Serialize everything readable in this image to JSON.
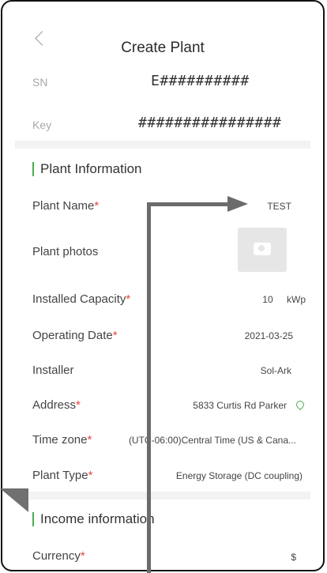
{
  "header": {
    "title": "Create Plant"
  },
  "device": {
    "sn_label": "SN",
    "sn_value": "E##########",
    "key_label": "Key",
    "key_value": "################"
  },
  "plant_info": {
    "section_title": "Plant Information",
    "fields": {
      "plant_name": {
        "label": "Plant Name",
        "value": "TEST"
      },
      "plant_photos": {
        "label": "Plant photos"
      },
      "capacity": {
        "label": "Installed Capacity",
        "value": "10",
        "unit": "kWp"
      },
      "operating_date": {
        "label": "Operating Date",
        "value": "2021-03-25"
      },
      "installer": {
        "label": "Installer",
        "value": "Sol-Ark"
      },
      "address": {
        "label": "Address",
        "value": "5833 Curtis Rd Parker"
      },
      "time_zone": {
        "label": "Time zone",
        "value": "(UTC-06:00)Central Time (US & Cana..."
      },
      "plant_type": {
        "label": "Plant Type",
        "value": "Energy Storage (DC coupling)"
      }
    }
  },
  "income_info": {
    "section_title": "Income information",
    "currency": {
      "label": "Currency",
      "value": "$"
    }
  },
  "required_mark": "*",
  "colors": {
    "accent": "#4caf50",
    "required": "#e8453c",
    "annotation": "#6b6b6b"
  }
}
